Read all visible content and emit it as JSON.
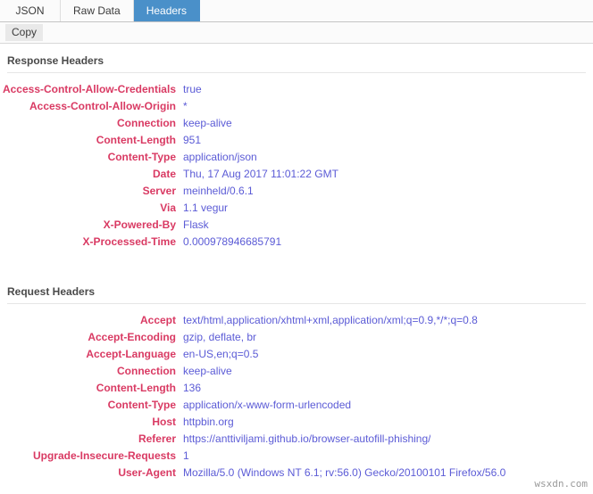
{
  "tabs": [
    {
      "label": "JSON",
      "active": false
    },
    {
      "label": "Raw Data",
      "active": false
    },
    {
      "label": "Headers",
      "active": true
    }
  ],
  "toolbar": {
    "copy_label": "Copy"
  },
  "colors": {
    "header_name": "#d93a63",
    "header_value": "#5b5bd6",
    "active_tab_bg": "#4a90c9",
    "section_title": "#4a4a4a"
  },
  "sections": [
    {
      "title": "Response Headers",
      "rows": [
        {
          "name": "Access-Control-Allow-Credentials",
          "value": "true"
        },
        {
          "name": "Access-Control-Allow-Origin",
          "value": "*"
        },
        {
          "name": "Connection",
          "value": "keep-alive"
        },
        {
          "name": "Content-Length",
          "value": "951"
        },
        {
          "name": "Content-Type",
          "value": "application/json"
        },
        {
          "name": "Date",
          "value": "Thu, 17 Aug 2017 11:01:22 GMT"
        },
        {
          "name": "Server",
          "value": "meinheld/0.6.1"
        },
        {
          "name": "Via",
          "value": "1.1 vegur"
        },
        {
          "name": "X-Powered-By",
          "value": "Flask"
        },
        {
          "name": "X-Processed-Time",
          "value": "0.000978946685791"
        }
      ]
    },
    {
      "title": "Request Headers",
      "rows": [
        {
          "name": "Accept",
          "value": "text/html,application/xhtml+xml,application/xml;q=0.9,*/*;q=0.8"
        },
        {
          "name": "Accept-Encoding",
          "value": "gzip, deflate, br"
        },
        {
          "name": "Accept-Language",
          "value": "en-US,en;q=0.5"
        },
        {
          "name": "Connection",
          "value": "keep-alive"
        },
        {
          "name": "Content-Length",
          "value": "136"
        },
        {
          "name": "Content-Type",
          "value": "application/x-www-form-urlencoded"
        },
        {
          "name": "Host",
          "value": "httpbin.org"
        },
        {
          "name": "Referer",
          "value": "https://anttiviljami.github.io/browser-autofill-phishing/"
        },
        {
          "name": "Upgrade-Insecure-Requests",
          "value": "1"
        },
        {
          "name": "User-Agent",
          "value": "Mozilla/5.0 (Windows NT 6.1; rv:56.0) Gecko/20100101 Firefox/56.0"
        }
      ]
    }
  ],
  "watermark": {
    "text": "wsxdn.com"
  }
}
